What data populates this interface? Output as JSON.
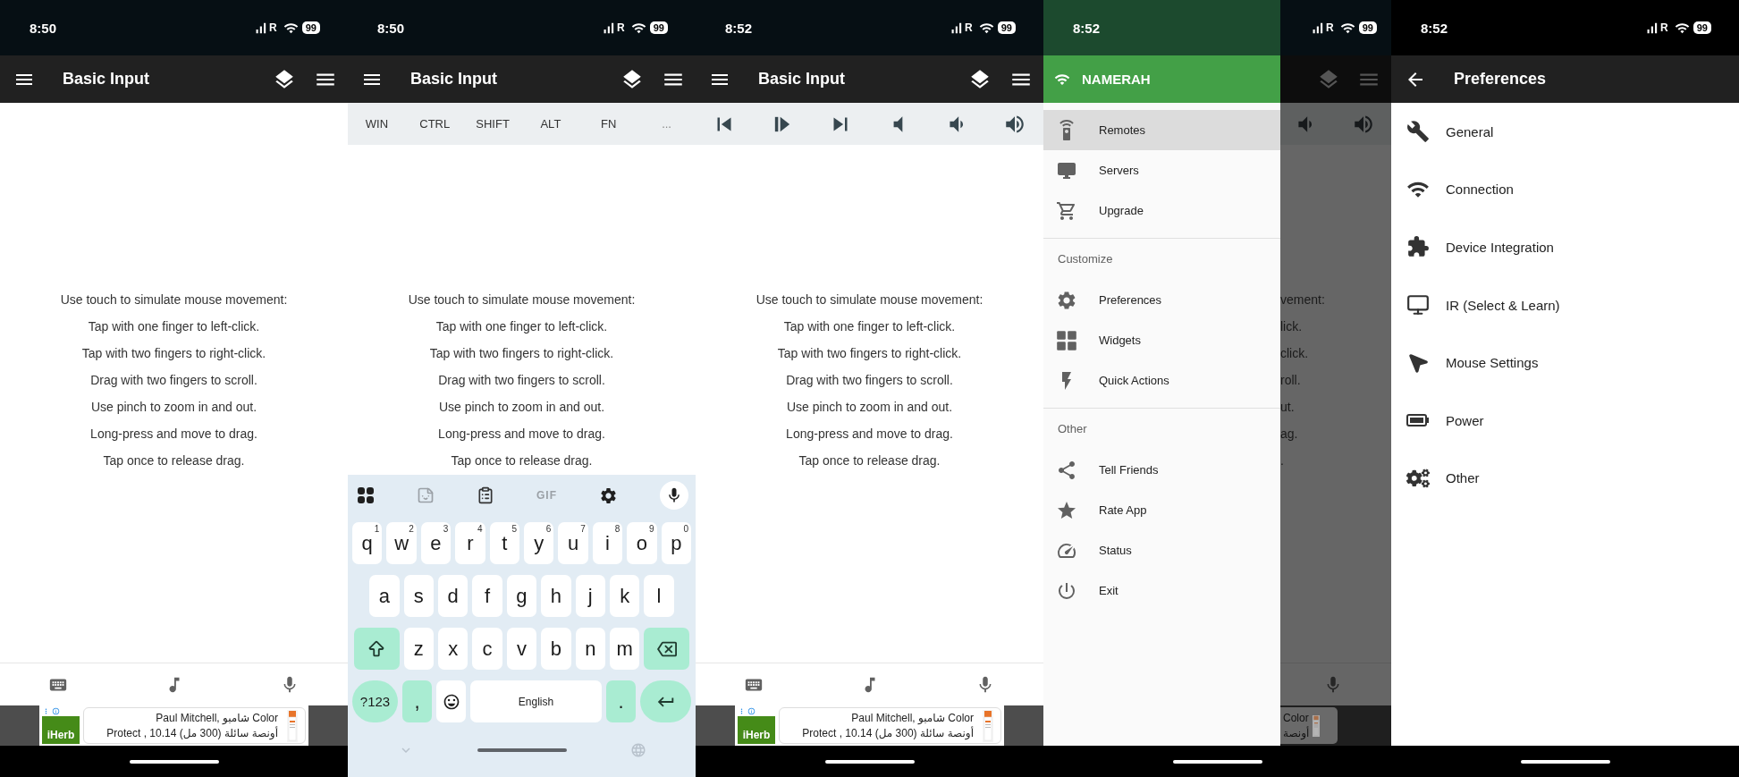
{
  "screens": [
    {
      "kind": "touchpad",
      "status_bar": {
        "time": "8:50",
        "network": "R",
        "battery": "99"
      },
      "app_bar": {
        "title": "Basic Input"
      },
      "instructions": [
        "Use touch to simulate mouse movement:",
        "Tap with one finger to left-click.",
        "Tap with two fingers to right-click.",
        "Drag with two fingers to scroll.",
        "Use pinch to zoom in and out.",
        "Long-press and move to drag.",
        "Tap once to release drag."
      ],
      "ad": {
        "brand": "iHerb",
        "line_1": "Paul Mitchell, شامبو Color",
        "line_2": "Protect , 10.14 أونصة سائلة (300 مل)"
      }
    },
    {
      "kind": "touchpad_keyboard",
      "status_bar": {
        "time": "8:50",
        "network": "R",
        "battery": "99"
      },
      "app_bar": {
        "title": "Basic Input"
      },
      "modifier_keys": [
        "WIN",
        "CTRL",
        "SHIFT",
        "ALT",
        "FN",
        "..."
      ],
      "instructions": [
        "Use touch to simulate mouse movement:",
        "Tap with one finger to left-click.",
        "Tap with two fingers to right-click.",
        "Drag with two fingers to scroll.",
        "Use pinch to zoom in and out.",
        "Long-press and move to drag.",
        "Tap once to release drag."
      ],
      "keyboard": {
        "toolbar_label": "GIF",
        "top_row": [
          {
            "key": "q",
            "hint": "1"
          },
          {
            "key": "w",
            "hint": "2"
          },
          {
            "key": "e",
            "hint": "3"
          },
          {
            "key": "r",
            "hint": "4"
          },
          {
            "key": "t",
            "hint": "5"
          },
          {
            "key": "y",
            "hint": "6"
          },
          {
            "key": "u",
            "hint": "7"
          },
          {
            "key": "i",
            "hint": "8"
          },
          {
            "key": "o",
            "hint": "9"
          },
          {
            "key": "p",
            "hint": "0"
          }
        ],
        "middle_row": [
          "a",
          "s",
          "d",
          "f",
          "g",
          "h",
          "j",
          "k",
          "l"
        ],
        "bottom_row": [
          "z",
          "x",
          "c",
          "v",
          "b",
          "n",
          "m"
        ],
        "symbols": "?123",
        "comma": ",",
        "space": "English",
        "period": "."
      }
    },
    {
      "kind": "touchpad_media",
      "status_bar": {
        "time": "8:52",
        "network": "R",
        "battery": "99"
      },
      "app_bar": {
        "title": "Basic Input"
      },
      "instructions": [
        "Use touch to simulate mouse movement:",
        "Tap with one finger to left-click.",
        "Tap with two fingers to right-click.",
        "Drag with two fingers to scroll.",
        "Use pinch to zoom in and out.",
        "Long-press and move to drag.",
        "Tap once to release drag."
      ],
      "ad": {
        "brand": "iHerb",
        "line_1": "Paul Mitchell, شامبو Color",
        "line_2": "Protect , 10.14 أونصة سائلة (300 مل)"
      }
    },
    {
      "kind": "drawer",
      "status_bar": {
        "time": "8:52",
        "network": "R",
        "battery": "99"
      },
      "drawer": {
        "network_name": "NAMERAH",
        "sections": [
          {
            "items": [
              {
                "label": "Remotes",
                "selected": true
              },
              {
                "label": "Servers",
                "selected": false
              },
              {
                "label": "Upgrade",
                "selected": false
              }
            ]
          },
          {
            "heading": "Customize",
            "items": [
              {
                "label": "Preferences",
                "selected": false
              },
              {
                "label": "Widgets",
                "selected": false
              },
              {
                "label": "Quick Actions",
                "selected": false
              }
            ]
          },
          {
            "heading": "Other",
            "items": [
              {
                "label": "Tell Friends",
                "selected": false
              },
              {
                "label": "Rate App",
                "selected": false
              },
              {
                "label": "Status",
                "selected": false
              },
              {
                "label": "Exit",
                "selected": false
              }
            ]
          }
        ]
      },
      "background_screen": {
        "instruction_fragments": [
          "vement:",
          "lick.",
          "click.",
          "roll.",
          "ut.",
          "ag.",
          "."
        ],
        "ad_fragments": [
          "Color",
          "أونصة"
        ]
      }
    },
    {
      "kind": "preferences",
      "status_bar": {
        "time": "8:52",
        "network": "R",
        "battery": "99"
      },
      "app_bar": {
        "title": "Preferences"
      },
      "items": [
        "General",
        "Connection",
        "Device Integration",
        "IR (Select & Learn)",
        "Mouse Settings",
        "Power",
        "Other"
      ]
    }
  ]
}
